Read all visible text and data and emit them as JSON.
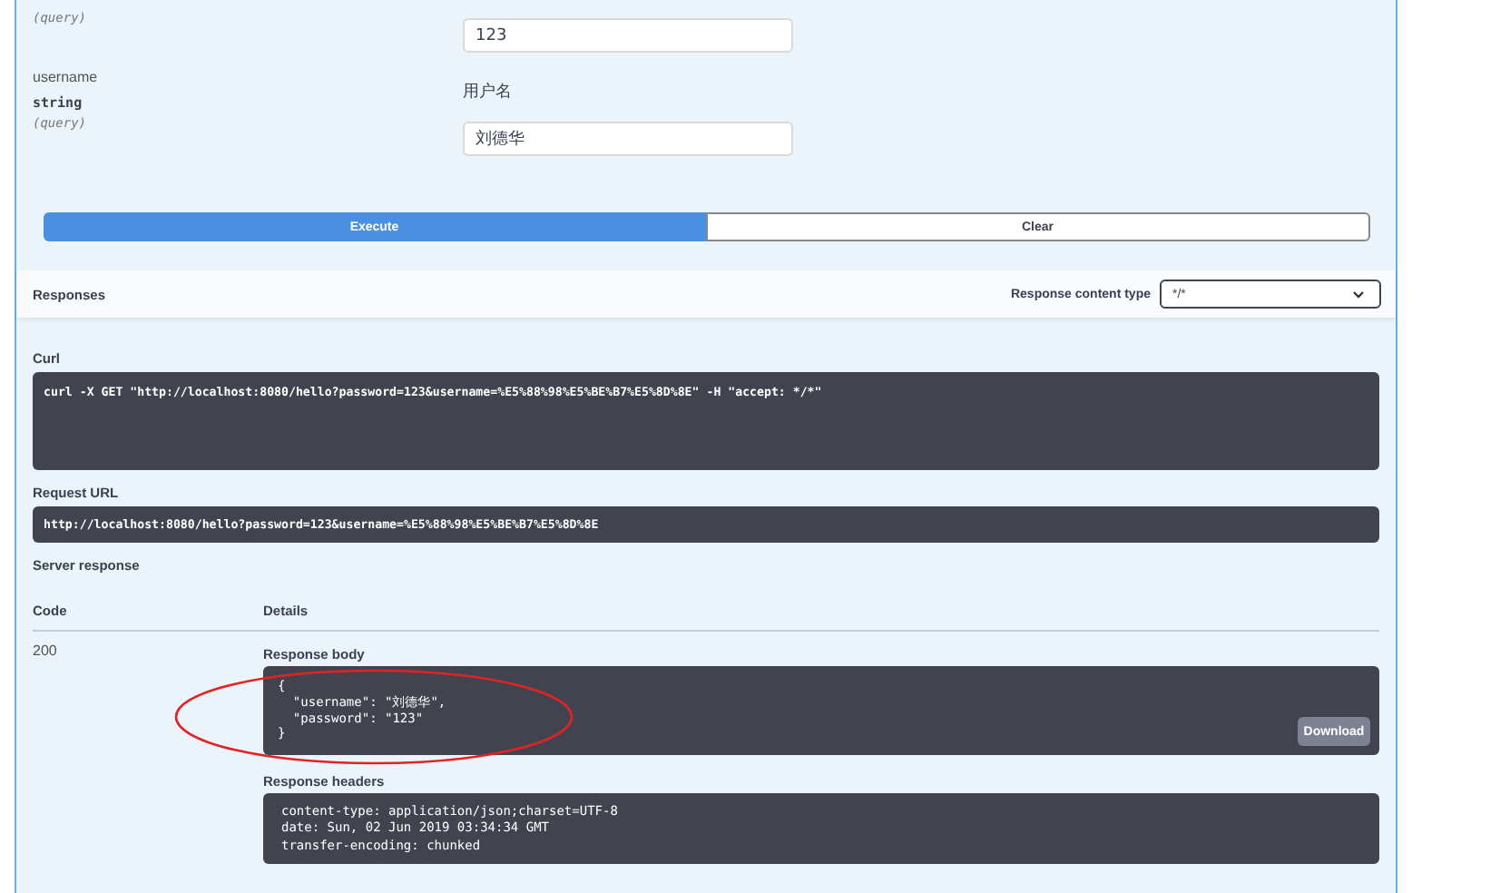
{
  "parameters": [
    {
      "in": "(query)",
      "value": "123"
    },
    {
      "name": "username",
      "type": "string",
      "in": "(query)",
      "description": "用户名",
      "value": "刘德华"
    }
  ],
  "buttons": [
    {
      "label": "Execute",
      "kind": "primary"
    },
    {
      "label": "Clear",
      "kind": "secondary"
    }
  ],
  "responses": {
    "title": "Responses",
    "content_type_label": "Response content type",
    "content_type": "*/*"
  },
  "curl": {
    "label": "Curl",
    "command": "curl -X GET \"http://localhost:8080/hello?password=123&username=%E5%88%98%E5%BE%B7%E5%8D%8E\" -H \"accept: */*\""
  },
  "request_url": {
    "label": "Request URL",
    "url": "http://localhost:8080/hello?password=123&username=%E5%88%98%E5%BE%B7%E5%8D%8E"
  },
  "server_response": {
    "title": "Server response",
    "columns": [
      "Code",
      "Details"
    ],
    "code": "200",
    "body_label": "Response body",
    "body": [
      "{",
      "  \"username\": \"刘德华\",",
      "  \"password\": \"123\"",
      "}"
    ],
    "download": "Download",
    "headers_label": "Response headers",
    "headers": [
      "content-type: application/json;charset=UTF-8",
      "date: Sun, 02 Jun 2019 03:34:34 GMT",
      "transfer-encoding: chunked"
    ]
  }
}
